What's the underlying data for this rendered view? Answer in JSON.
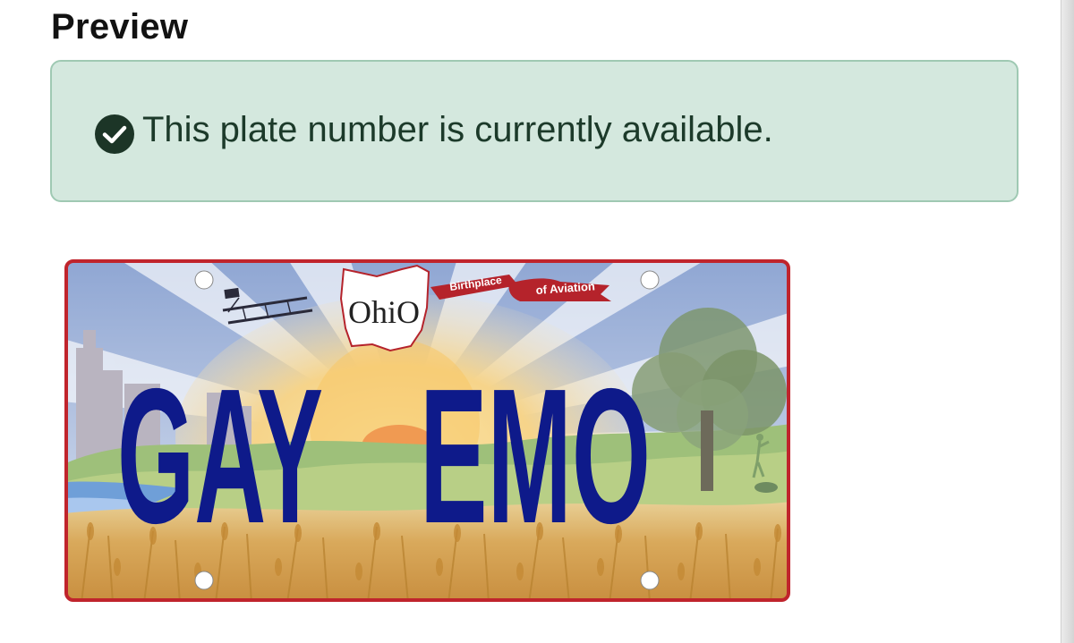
{
  "preview": {
    "heading": "Preview"
  },
  "availability": {
    "message": "This plate number is currently available.",
    "icon": "check-circle-icon",
    "status_color": "#1e4a32"
  },
  "plate": {
    "state": "OhiO",
    "banner_left": "Birthplace",
    "banner_right": "of Aviation",
    "number_part1": "GAY",
    "number_part2": "EMO",
    "number_color": "#0e1a8a",
    "border_color": "#c0242c"
  }
}
